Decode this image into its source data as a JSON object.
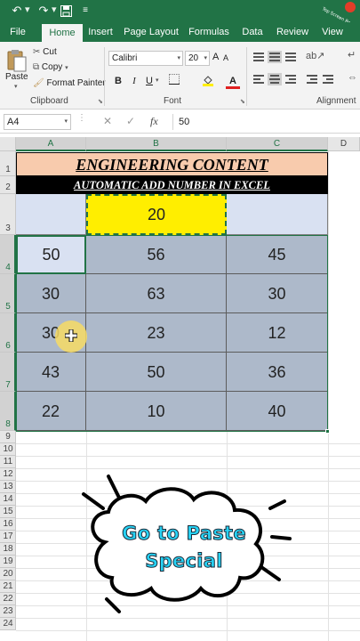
{
  "qat": {
    "undo": "↶",
    "redo": "↷",
    "save": "💾",
    "more": "⌄"
  },
  "tabs": [
    "File",
    "Home",
    "Insert",
    "Page Layout",
    "Formulas",
    "Data",
    "Review",
    "View"
  ],
  "ribbon": {
    "clipboard": {
      "paste": "Paste",
      "cut": "Cut",
      "copy": "Copy",
      "format_painter": "Format Painter",
      "label": "Clipboard"
    },
    "font": {
      "name": "Calibri",
      "size": "20",
      "bold": "B",
      "italic": "I",
      "underline": "U",
      "label": "Font"
    },
    "alignment": {
      "label": "Alignment"
    }
  },
  "formula_bar": {
    "name_box": "A4",
    "cancel": "✕",
    "enter": "✓",
    "fx": "fx",
    "value": "50"
  },
  "columns": [
    "A",
    "B",
    "C",
    "D"
  ],
  "rows": [
    "1",
    "2",
    "3",
    "4",
    "5",
    "6",
    "7",
    "8",
    "9",
    "10",
    "11",
    "12",
    "13",
    "14",
    "15",
    "16",
    "17",
    "18",
    "19",
    "20",
    "21",
    "22",
    "23",
    "24"
  ],
  "sheet": {
    "title": "ENGINEERING CONTENT",
    "subtitle": "AUTOMATIC ADD NUMBER  IN EXCEL",
    "b3": "20",
    "values": [
      [
        "50",
        "56",
        "45"
      ],
      [
        "30",
        "63",
        "30"
      ],
      [
        "30",
        "23",
        "12"
      ],
      [
        "43",
        "50",
        "36"
      ],
      [
        "22",
        "10",
        "40"
      ]
    ]
  },
  "bubble": {
    "line1": "Go to Paste",
    "line2": "Special"
  },
  "watermark": "Top Screen Recorder",
  "colors": {
    "excel_green": "#217346",
    "title_fill": "#f8cbad",
    "yellow": "#ffee00",
    "data_fill": "#adb9ca",
    "bubble_text": "#27d3f5"
  }
}
